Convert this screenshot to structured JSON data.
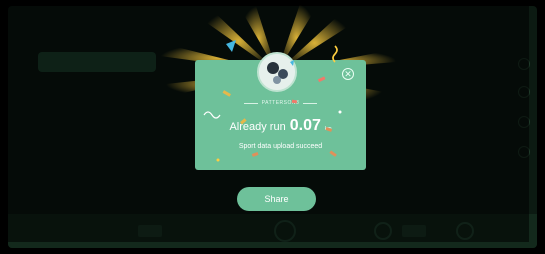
{
  "popup": {
    "nickname": "PATTERSON8",
    "distance_prefix": "Already run",
    "distance_value": "0.07",
    "distance_unit": "km",
    "upload_status": "Sport data upload succeed",
    "close_icon": "close-icon",
    "avatar_icon": "avatar"
  },
  "actions": {
    "share_label": "Share"
  },
  "colors": {
    "card": "#6ec19a",
    "button": "#6ec19a",
    "backdrop": "#000000"
  }
}
